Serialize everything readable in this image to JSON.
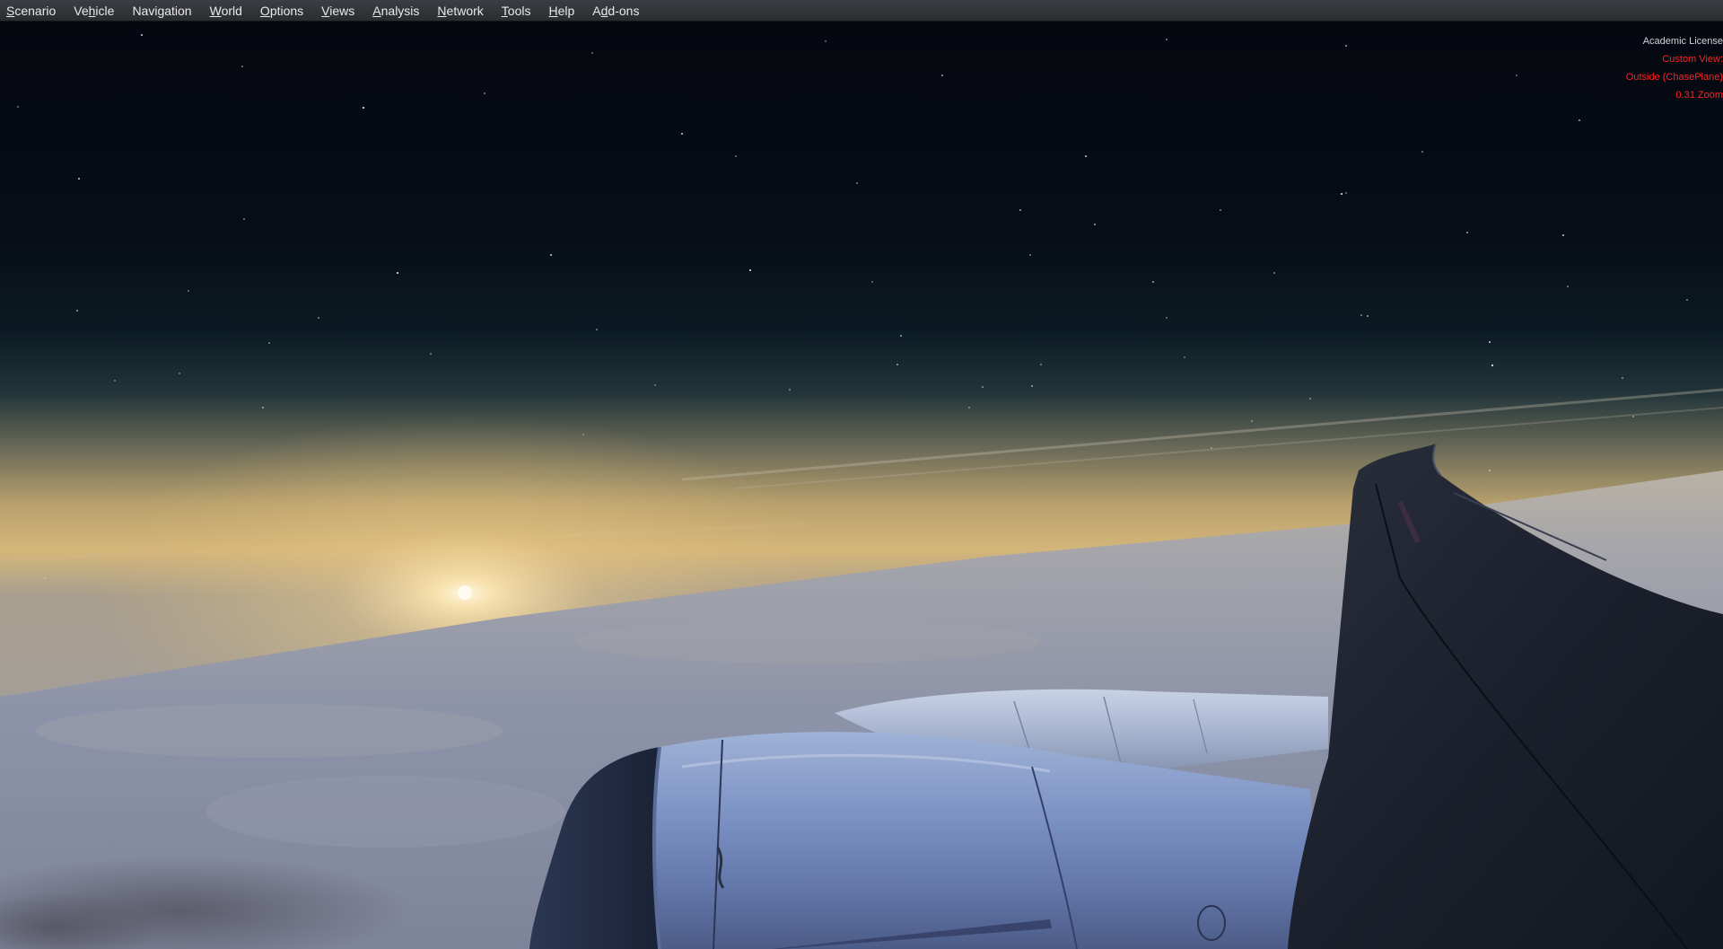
{
  "menubar": {
    "items": [
      {
        "pre": "",
        "mn": "S",
        "post": "cenario"
      },
      {
        "pre": "Ve",
        "mn": "h",
        "post": "icle"
      },
      {
        "pre": "Navigation",
        "mn": "",
        "post": ""
      },
      {
        "pre": "",
        "mn": "W",
        "post": "orld"
      },
      {
        "pre": "",
        "mn": "O",
        "post": "ptions"
      },
      {
        "pre": "",
        "mn": "V",
        "post": "iews"
      },
      {
        "pre": "",
        "mn": "A",
        "post": "nalysis"
      },
      {
        "pre": "",
        "mn": "N",
        "post": "etwork"
      },
      {
        "pre": "",
        "mn": "T",
        "post": "ools"
      },
      {
        "pre": "",
        "mn": "H",
        "post": "elp"
      },
      {
        "pre": "A",
        "mn": "d",
        "post": "d-ons"
      }
    ]
  },
  "overlay": {
    "license": "Academic License",
    "view_label": "Custom View:",
    "view_name": "Outside (ChasePlane)",
    "zoom": "0.31 Zoom"
  },
  "scene": {
    "sky_top_color": "#05080f",
    "horizon_glow_color": "#d9b775",
    "cloud_color": "#8d93a8",
    "engine_color": "#6d82b5",
    "wing_color": "#1b202c"
  }
}
